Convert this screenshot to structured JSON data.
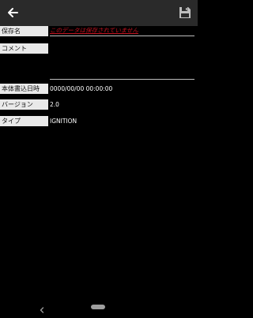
{
  "toolbar": {
    "back_icon": "arrow-left-icon",
    "save_icon": "floppy-disk-icon"
  },
  "fields": {
    "name_label": "保存名",
    "name_value": "このデータは保存されていません",
    "comment_label": "コメント",
    "comment_value": "",
    "datetime_label": "本体書込日時",
    "datetime_value": "0000/00/00 00:00:00",
    "version_label": "バージョン",
    "version_value": "2.0",
    "type_label": "タイプ",
    "type_value": "IGNITION"
  },
  "colors": {
    "background": "#000000",
    "topbar": "#2a2a2a",
    "label_bg": "#e9e9e9",
    "warning_text": "#c1121f"
  },
  "system_nav": {
    "back_icon": "chevron-left-icon",
    "home_icon": "home-pill-icon"
  }
}
